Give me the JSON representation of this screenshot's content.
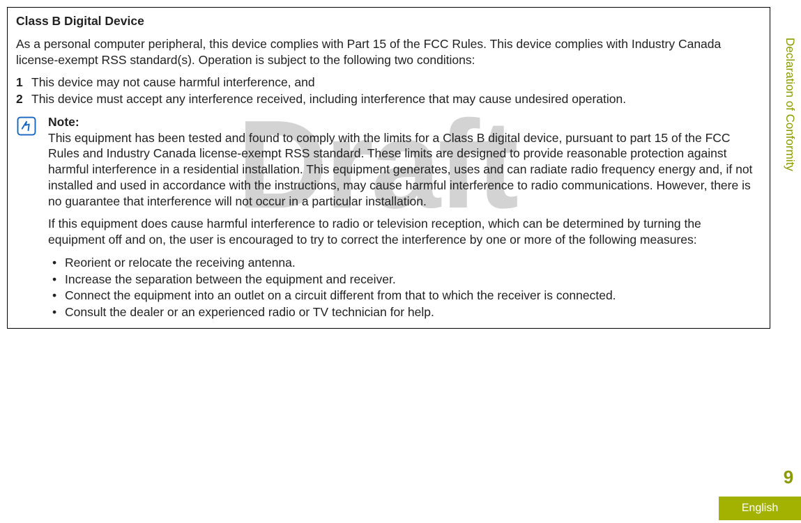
{
  "watermark": "Draft",
  "box": {
    "title": "Class B Digital Device",
    "intro": "As a personal computer peripheral, this device complies with Part 15 of the FCC Rules. This device complies with Industry Canada license-exempt RSS standard(s). Operation is subject to the following two conditions:",
    "numbered": [
      {
        "n": "1",
        "t": "This device may not cause harmful interference, and"
      },
      {
        "n": "2",
        "t": "This device must accept any interference received, including interference that may cause undesired operation."
      }
    ],
    "note": {
      "label": "Note:",
      "p1": "This equipment has been tested and found to comply with the limits for a Class B digital device, pursuant to part 15 of the FCC Rules and Industry Canada license-exempt RSS standard. These limits are designed to provide reasonable protection against harmful interference in a residential installation. This equipment generates, uses and can radiate radio frequency energy and, if not installed and used in accordance with the instructions, may cause harmful interference to radio communications. However, there is no guarantee that interference will not occur in a particular installation.",
      "p2": "If this equipment does cause harmful interference to radio or television reception, which can be determined by turning the equipment off and on, the user is encouraged to try to correct the interference by one or more of the following measures:",
      "bullets": [
        "Reorient or relocate the receiving antenna.",
        "Increase the separation between the equipment and receiver.",
        "Connect the equipment into an outlet on a circuit different from that to which the receiver is connected.",
        "Consult the dealer or an experienced radio or TV technician for help."
      ]
    }
  },
  "sideTab": "Declaration of Conformity",
  "pageNumber": "9",
  "language": "English"
}
